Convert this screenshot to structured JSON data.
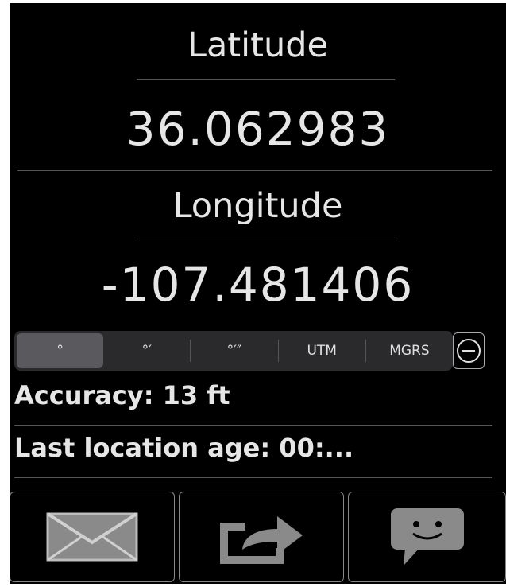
{
  "latitude": {
    "label": "Latitude",
    "value": "36.062983"
  },
  "longitude": {
    "label": "Longitude",
    "value": "-107.481406"
  },
  "format_segments": [
    {
      "label": "°",
      "selected": true
    },
    {
      "label": "°′",
      "selected": false
    },
    {
      "label": "°′″",
      "selected": false
    },
    {
      "label": "UTM",
      "selected": false
    },
    {
      "label": "MGRS",
      "selected": false
    }
  ],
  "accuracy_text": "Accuracy: 13 ft",
  "location_age_text": "Last location age: 00:...",
  "actions": [
    {
      "icon": "mail-icon"
    },
    {
      "icon": "share-icon"
    },
    {
      "icon": "message-icon"
    }
  ],
  "colors": {
    "background": "#000000",
    "text": "#e6e6e6",
    "selected_segment": "#5a5a5e",
    "icon_gray": "#8a8a8a"
  }
}
